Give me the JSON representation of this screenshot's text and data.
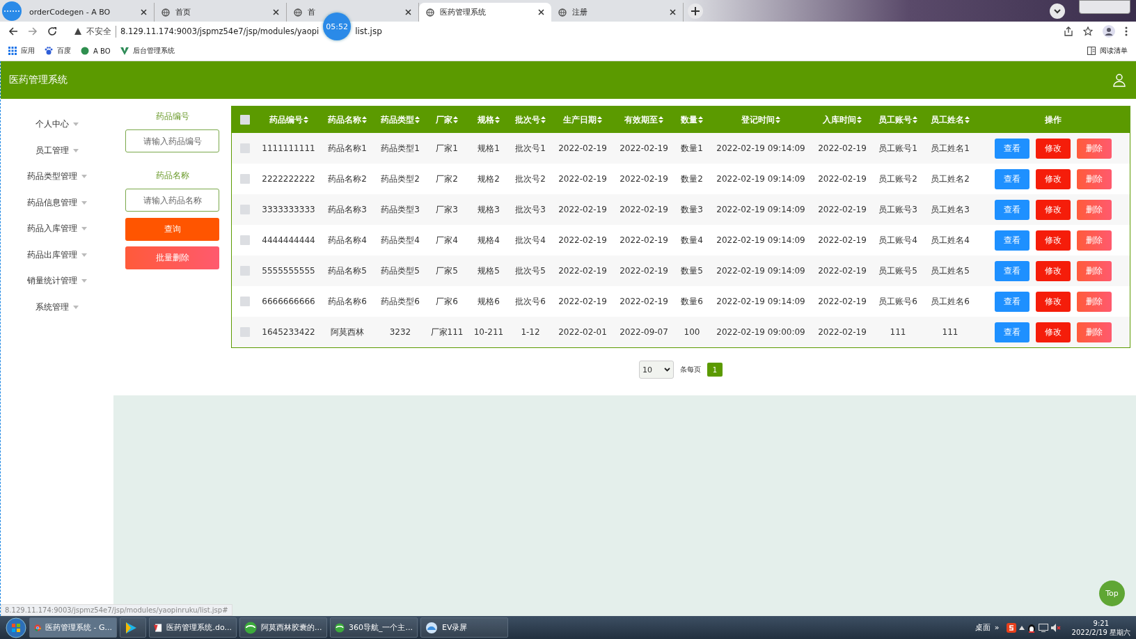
{
  "browser": {
    "tabs": [
      {
        "title": "orderCodegen - A BO",
        "selected": false
      },
      {
        "title": "首页",
        "selected": false
      },
      {
        "title": "首",
        "selected": false
      },
      {
        "title": "医药管理系统",
        "selected": true
      },
      {
        "title": "注册",
        "selected": false
      }
    ],
    "timer": "05:52",
    "security": "不安全",
    "url": "8.129.11.174:9003/jspmz54e7/jsp/modules/yaopi",
    "url_tail": "list.jsp",
    "bookmarks": [
      "应用",
      "百度",
      "A BO",
      "后台管理系统"
    ],
    "reading_list": "阅读清单"
  },
  "app": {
    "title": "医药管理系统"
  },
  "sidebar": {
    "items": [
      {
        "label": "个人中心"
      },
      {
        "label": "员工管理"
      },
      {
        "label": "药品类型管理"
      },
      {
        "label": "药品信息管理"
      },
      {
        "label": "药品入库管理"
      },
      {
        "label": "药品出库管理"
      },
      {
        "label": "销量统计管理"
      },
      {
        "label": "系统管理"
      }
    ]
  },
  "search": {
    "fields": [
      {
        "label": "药品编号",
        "placeholder": "请输入药品编号"
      },
      {
        "label": "药品名称",
        "placeholder": "请输入药品名称"
      }
    ],
    "buttons": [
      {
        "label": "查询",
        "kind": "query"
      },
      {
        "label": "批量删除",
        "kind": "batch-delete"
      }
    ]
  },
  "table": {
    "select_all": {
      "checked": false
    },
    "columns": [
      {
        "label": "药品编号",
        "sortable": true
      },
      {
        "label": "药品名称",
        "sortable": true
      },
      {
        "label": "药品类型",
        "sortable": true
      },
      {
        "label": "厂家",
        "sortable": true
      },
      {
        "label": "规格",
        "sortable": true
      },
      {
        "label": "批次号",
        "sortable": true
      },
      {
        "label": "生产日期",
        "sortable": true
      },
      {
        "label": "有效期至",
        "sortable": true
      },
      {
        "label": "数量",
        "sortable": true
      },
      {
        "label": "登记时间",
        "sortable": true
      },
      {
        "label": "入库时间",
        "sortable": true
      },
      {
        "label": "员工账号",
        "sortable": true
      },
      {
        "label": "员工姓名",
        "sortable": true
      },
      {
        "label": "操作",
        "sortable": false
      }
    ],
    "rows": [
      {
        "checked": false,
        "cells": [
          "1111111111",
          "药品名称1",
          "药品类型1",
          "厂家1",
          "规格1",
          "批次号1",
          "2022-02-19",
          "2022-02-19",
          "数量1",
          "2022-02-19 09:14:09",
          "2022-02-19",
          "员工账号1",
          "员工姓名1"
        ],
        "actions": [
          {
            "label": "查看",
            "kind": "view"
          },
          {
            "label": "修改",
            "kind": "edit"
          },
          {
            "label": "删除",
            "kind": "delete"
          }
        ]
      },
      {
        "checked": false,
        "cells": [
          "2222222222",
          "药品名称2",
          "药品类型2",
          "厂家2",
          "规格2",
          "批次号2",
          "2022-02-19",
          "2022-02-19",
          "数量2",
          "2022-02-19 09:14:09",
          "2022-02-19",
          "员工账号2",
          "员工姓名2"
        ],
        "actions": [
          {
            "label": "查看",
            "kind": "view"
          },
          {
            "label": "修改",
            "kind": "edit"
          },
          {
            "label": "删除",
            "kind": "delete"
          }
        ]
      },
      {
        "checked": false,
        "cells": [
          "3333333333",
          "药品名称3",
          "药品类型3",
          "厂家3",
          "规格3",
          "批次号3",
          "2022-02-19",
          "2022-02-19",
          "数量3",
          "2022-02-19 09:14:09",
          "2022-02-19",
          "员工账号3",
          "员工姓名3"
        ],
        "actions": [
          {
            "label": "查看",
            "kind": "view"
          },
          {
            "label": "修改",
            "kind": "edit"
          },
          {
            "label": "删除",
            "kind": "delete"
          }
        ]
      },
      {
        "checked": false,
        "cells": [
          "4444444444",
          "药品名称4",
          "药品类型4",
          "厂家4",
          "规格4",
          "批次号4",
          "2022-02-19",
          "2022-02-19",
          "数量4",
          "2022-02-19 09:14:09",
          "2022-02-19",
          "员工账号4",
          "员工姓名4"
        ],
        "actions": [
          {
            "label": "查看",
            "kind": "view"
          },
          {
            "label": "修改",
            "kind": "edit"
          },
          {
            "label": "删除",
            "kind": "delete"
          }
        ]
      },
      {
        "checked": false,
        "cells": [
          "5555555555",
          "药品名称5",
          "药品类型5",
          "厂家5",
          "规格5",
          "批次号5",
          "2022-02-19",
          "2022-02-19",
          "数量5",
          "2022-02-19 09:14:09",
          "2022-02-19",
          "员工账号5",
          "员工姓名5"
        ],
        "actions": [
          {
            "label": "查看",
            "kind": "view"
          },
          {
            "label": "修改",
            "kind": "edit"
          },
          {
            "label": "删除",
            "kind": "delete"
          }
        ]
      },
      {
        "checked": false,
        "cells": [
          "6666666666",
          "药品名称6",
          "药品类型6",
          "厂家6",
          "规格6",
          "批次号6",
          "2022-02-19",
          "2022-02-19",
          "数量6",
          "2022-02-19 09:14:09",
          "2022-02-19",
          "员工账号6",
          "员工姓名6"
        ],
        "actions": [
          {
            "label": "查看",
            "kind": "view"
          },
          {
            "label": "修改",
            "kind": "edit"
          },
          {
            "label": "删除",
            "kind": "delete"
          }
        ]
      },
      {
        "checked": false,
        "cells": [
          "1645233422",
          "阿莫西林",
          "3232",
          "厂家111",
          "10-211",
          "1-12",
          "2022-02-01",
          "2022-09-07",
          "100",
          "2022-02-19 09:00:09",
          "2022-02-19",
          "111",
          "111"
        ],
        "actions": [
          {
            "label": "查看",
            "kind": "view"
          },
          {
            "label": "修改",
            "kind": "edit"
          },
          {
            "label": "删除",
            "kind": "delete"
          }
        ]
      }
    ]
  },
  "pagination": {
    "page_size": "10",
    "per_page_label": "条每页",
    "pages": [
      {
        "label": "1",
        "selected": true
      }
    ]
  },
  "top_button": "Top",
  "status_url": "8.129.11.174:9003/jspmz54e7/jsp/modules/yaopinruku/list.jsp#",
  "taskbar": {
    "items": [
      {
        "label": "医药管理系统 - G...",
        "kind": "chrome",
        "selected": true
      },
      {
        "kind": "player",
        "selected": false
      },
      {
        "label": "医药管理系统.do...",
        "kind": "doc",
        "selected": false
      },
      {
        "label": "阿莫西林胶囊的...",
        "kind": "browser360",
        "selected": false
      },
      {
        "label": "360导航_一个主...",
        "kind": "browser360",
        "selected": false
      },
      {
        "label": "EV录屏",
        "kind": "ev",
        "selected": false
      }
    ],
    "desktop": "桌面",
    "chevron": "»",
    "time": "9:21",
    "date": "2022/2/19 星期六"
  }
}
